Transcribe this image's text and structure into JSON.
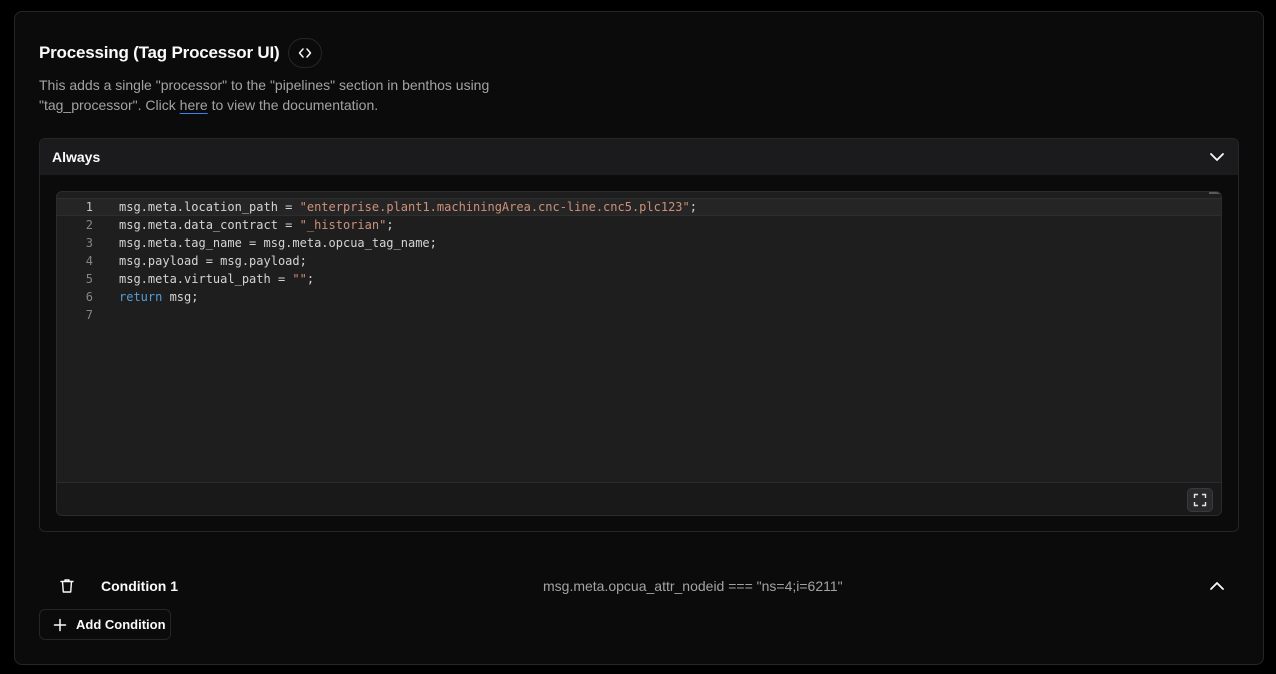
{
  "section": {
    "title": "Processing (Tag Processor UI)",
    "description_pre": "This adds a single \"processor\" to the \"pipelines\" section in benthos using \"tag_processor\". Click ",
    "link_text": "here",
    "description_post": " to view the documentation."
  },
  "always_panel": {
    "title": "Always",
    "code_lines": [
      {
        "num": "1",
        "segments": [
          {
            "t": "msg.meta.location_path = ",
            "c": "plain"
          },
          {
            "t": "\"enterprise.plant1.machiningArea.cnc-line.cnc5.plc123\"",
            "c": "str"
          },
          {
            "t": ";",
            "c": "plain"
          }
        ]
      },
      {
        "num": "2",
        "segments": [
          {
            "t": "msg.meta.data_contract = ",
            "c": "plain"
          },
          {
            "t": "\"_historian\"",
            "c": "str"
          },
          {
            "t": ";",
            "c": "plain"
          }
        ]
      },
      {
        "num": "3",
        "segments": [
          {
            "t": "msg.meta.tag_name = msg.meta.opcua_tag_name;",
            "c": "plain"
          }
        ]
      },
      {
        "num": "4",
        "segments": [
          {
            "t": "msg.payload = msg.payload;",
            "c": "plain"
          }
        ]
      },
      {
        "num": "5",
        "segments": [
          {
            "t": "msg.meta.virtual_path = ",
            "c": "plain"
          },
          {
            "t": "\"\"",
            "c": "str"
          },
          {
            "t": ";",
            "c": "plain"
          }
        ]
      },
      {
        "num": "6",
        "segments": [
          {
            "t": "return",
            "c": "kw"
          },
          {
            "t": " msg;",
            "c": "plain"
          }
        ]
      },
      {
        "num": "7",
        "segments": []
      }
    ]
  },
  "conditions": [
    {
      "label": "Condition 1",
      "expression": "msg.meta.opcua_attr_nodeid === \"ns=4;i=6211\""
    }
  ],
  "add_condition_label": "Add Condition",
  "icons": {
    "code": "code-brackets-icon",
    "collapse": "chevron-down-icon",
    "expand": "chevron-up-icon",
    "fullscreen": "fullscreen-icon",
    "delete": "trash-icon",
    "add": "plus-icon"
  },
  "colors": {
    "string": "#ce9178",
    "keyword": "#569cd6",
    "link_underline": "#3b82f6"
  }
}
